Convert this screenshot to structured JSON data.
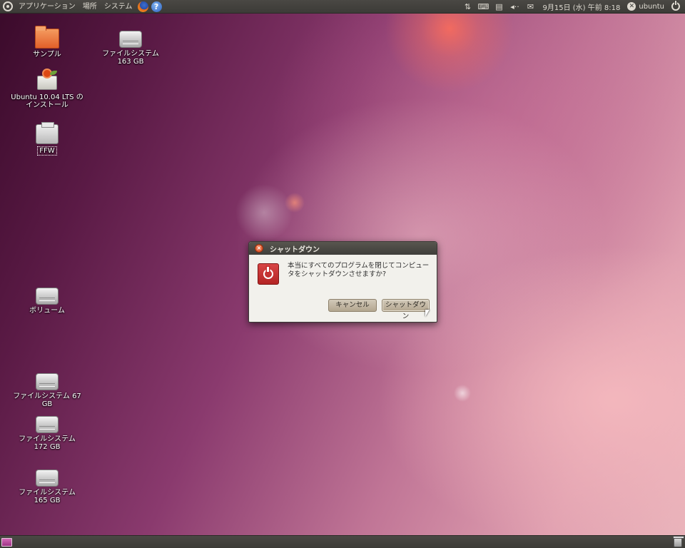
{
  "top_panel": {
    "menus": [
      "アプリケーション",
      "場所",
      "システム"
    ],
    "help_glyph": "?",
    "tray_icons": [
      "network-icon",
      "keyboard-icon",
      "clipboard-icon",
      "volume-icon",
      "mail-icon"
    ],
    "volume_glyph": "◂··",
    "mail_glyph": "✉",
    "network_glyph": "⇅",
    "keyboard_glyph": "⌨",
    "clipboard_glyph": "▤",
    "clock": "9月15日 (水) 午前 8:18",
    "me_glyph": "✕",
    "username": "ubuntu"
  },
  "desktop_icons": {
    "sample": "サンプル",
    "fs163": "ファイルシステム 163 GB",
    "installer": "Ubuntu 10.04 LTS の インストール",
    "ffw": "FFW",
    "volume": "ボリューム",
    "fs67": "ファイルシステム 67 GB",
    "fs172": "ファイルシステム 172 GB",
    "fs165": "ファイルシステム 165 GB"
  },
  "dialog": {
    "title": "シャットダウン",
    "close_glyph": "×",
    "message": "本当にすべてのプログラムを閉じてコンピュータをシャットダウンさせますか?",
    "cancel_label": "キャンセル",
    "shutdown_label": "シャットダウン"
  },
  "colors": {
    "panel": "#3c3b37",
    "panel_text": "#dfdbd2",
    "dialog_bg": "#f2f1ec",
    "accent_red": "#c42e2e",
    "button": "#c3b8a4"
  }
}
